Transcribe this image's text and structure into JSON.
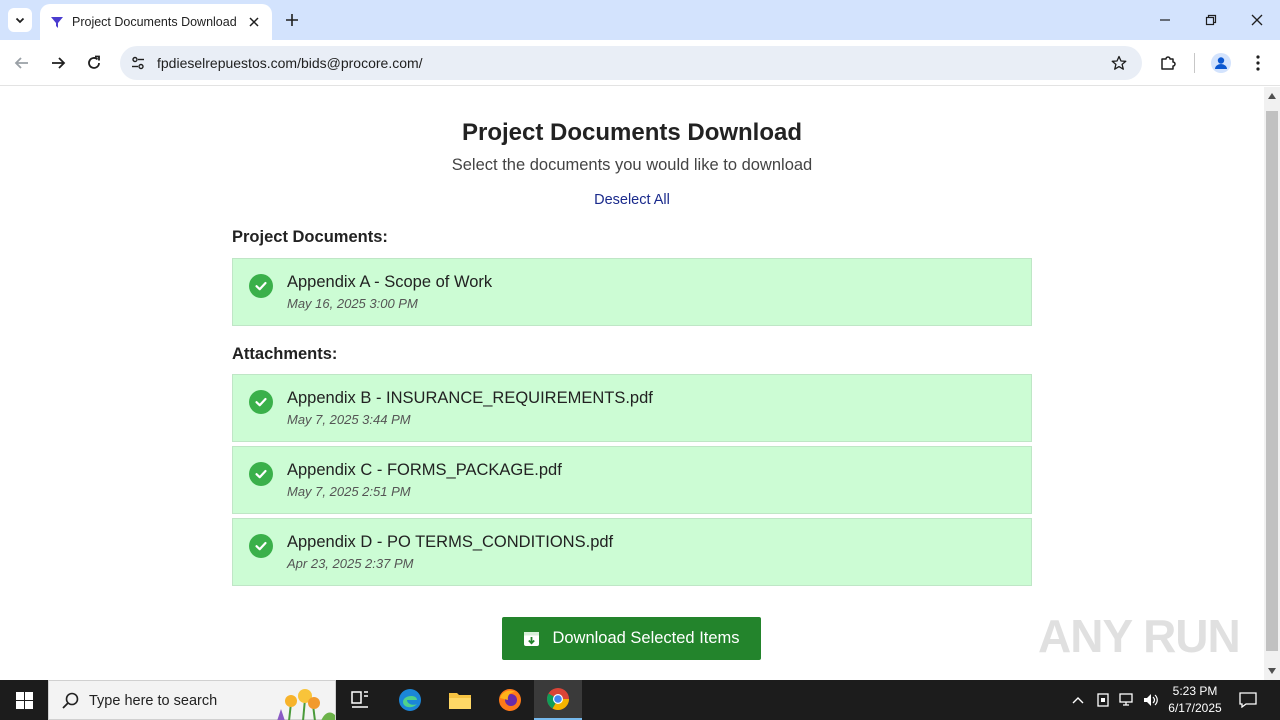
{
  "browser": {
    "tab_title": "Project Documents Download",
    "url": "fpdieselrepuestos.com/bids@procore.com/"
  },
  "page": {
    "title": "Project Documents Download",
    "subtitle": "Select the documents you would like to download",
    "deselect_label": "Deselect All",
    "sections": [
      {
        "label": "Project Documents:",
        "documents": [
          {
            "name": "Appendix A - Scope of Work",
            "date": "May 16, 2025 3:00 PM",
            "selected": true
          }
        ]
      },
      {
        "label": "Attachments:",
        "documents": [
          {
            "name": "Appendix B - INSURANCE_REQUIREMENTS.pdf",
            "date": "May 7, 2025 3:44 PM",
            "selected": true
          },
          {
            "name": "Appendix C - FORMS_PACKAGE.pdf",
            "date": "May 7, 2025 2:51 PM",
            "selected": true
          },
          {
            "name": "Appendix D - PO TERMS_CONDITIONS.pdf",
            "date": "Apr 23, 2025 2:37 PM",
            "selected": true
          }
        ]
      }
    ],
    "download_label": "Download Selected Items",
    "watermark_text": "ANY RUN"
  },
  "taskbar": {
    "search_placeholder": "Type here to search",
    "time": "5:23 PM",
    "date": "6/17/2025"
  },
  "colors": {
    "tabstrip": "#d3e3fd",
    "doc_selected_bg": "#ccfcd4",
    "check_green": "#3ab04a",
    "download_button": "#23842c",
    "link_blue": "#1a2a8c",
    "taskbar": "#1c1c1c"
  },
  "icons": {
    "tab_favicon": "procore-funnel-icon",
    "check": "check-circle-icon",
    "download": "archive-download-icon"
  }
}
